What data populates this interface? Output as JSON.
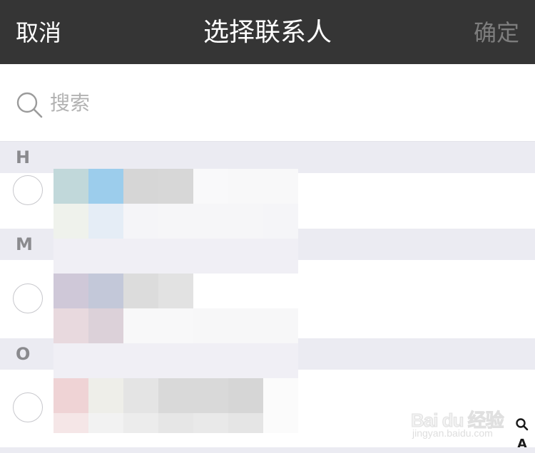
{
  "header": {
    "cancel_label": "取消",
    "title": "选择联系人",
    "confirm_label": "确定"
  },
  "search": {
    "placeholder": "搜索",
    "value": "",
    "icon": "search-icon"
  },
  "sections": [
    {
      "letter": "H"
    },
    {
      "letter": "M"
    },
    {
      "letter": "O"
    }
  ],
  "index_bar": {
    "items": [
      "search-icon",
      "A"
    ]
  },
  "watermark": {
    "main": "Bai du 经验",
    "sub": "jingyan.baidu.com"
  },
  "colors": {
    "navbar_bg": "#353535",
    "section_bg": "#ebebf2",
    "confirm_disabled": "#7d7d7d",
    "radio_border": "#c7c7cc"
  }
}
